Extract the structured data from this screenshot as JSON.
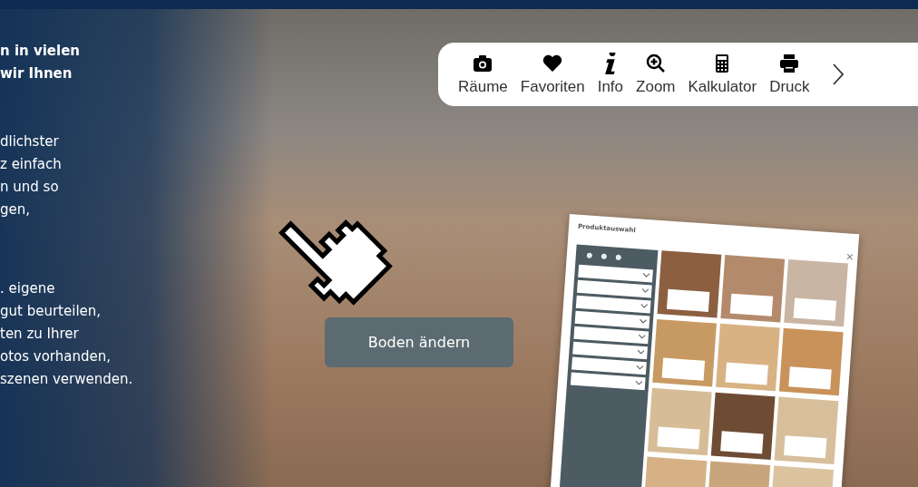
{
  "intro_text": {
    "paragraphs": [
      {
        "bold": true,
        "lines": [
          "n in vielen",
          "wir Ihnen"
        ]
      },
      {
        "bold": false,
        "lines": [
          "dlichster",
          "z einfach",
          "n und so",
          "gen,"
        ]
      },
      {
        "bold": false,
        "lines": [
          ". eigene",
          "gut beurteilen,",
          "ten zu Ihrer",
          "otos vorhanden,",
          "szenen verwenden."
        ]
      }
    ]
  },
  "toolbar": {
    "items": [
      {
        "kind": "camera",
        "label": "Räume"
      },
      {
        "kind": "heart",
        "label": "Favoriten"
      },
      {
        "kind": "info",
        "label": "Info"
      },
      {
        "kind": "zoom",
        "label": "Zoom"
      },
      {
        "kind": "calculator",
        "label": "Kalkulator"
      },
      {
        "kind": "print",
        "label": "Druck"
      }
    ]
  },
  "hint": {
    "label": "Boden ändern"
  },
  "product_panel": {
    "title": "Produktauswahl",
    "close": "×",
    "tiles": [
      {
        "color": "#8b5f40"
      },
      {
        "color": "#b48a6c"
      },
      {
        "color": "#c9b5a3"
      },
      {
        "color": "#c89a63"
      },
      {
        "color": "#d8b283"
      },
      {
        "color": "#c8925a"
      },
      {
        "color": "#d7bd97"
      },
      {
        "color": "#6e4b33"
      },
      {
        "color": "#d8bf9c"
      },
      {
        "color": "#d5b185"
      },
      {
        "color": "#c9a57c"
      },
      {
        "color": "#dcc3a0"
      }
    ]
  }
}
